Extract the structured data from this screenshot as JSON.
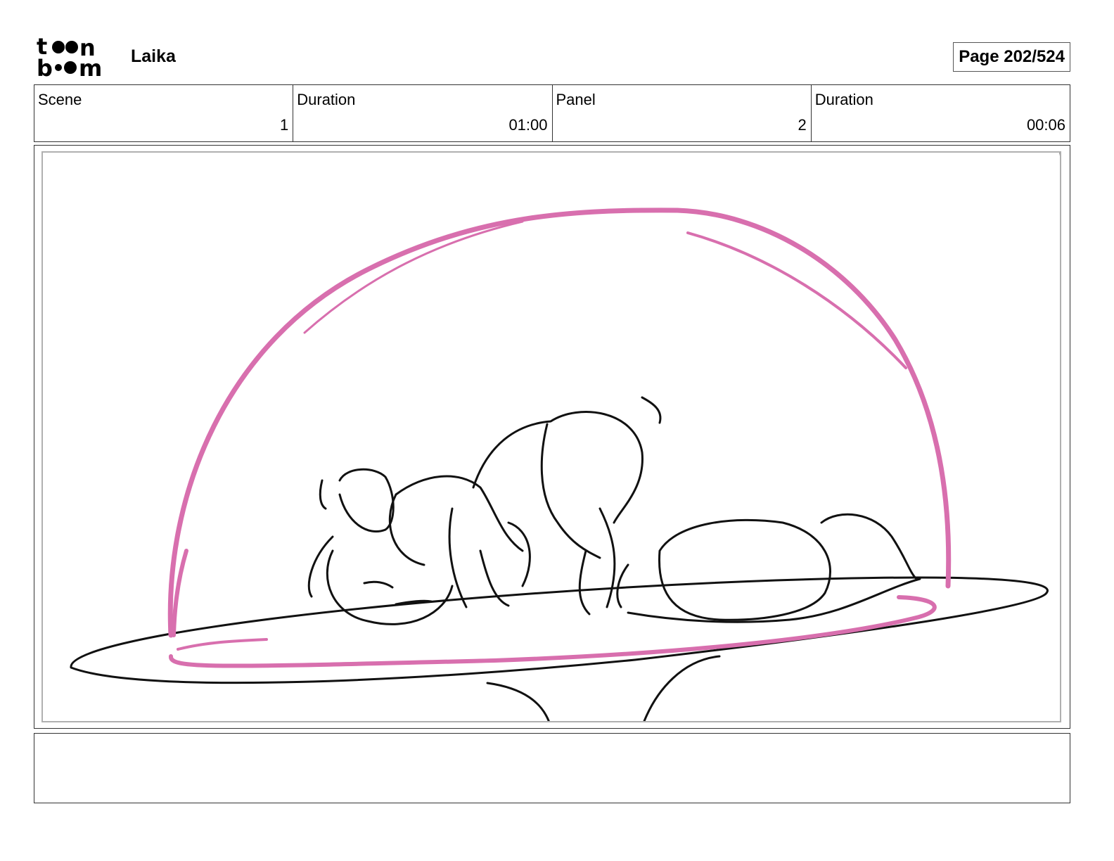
{
  "header": {
    "logo_line1": "toon",
    "logo_line2": "boom",
    "project_title": "Laika",
    "page_label": "Page 202/524"
  },
  "info": {
    "scene_label": "Scene",
    "scene_value": "1",
    "scene_duration_label": "Duration",
    "scene_duration_value": "01:00",
    "panel_label": "Panel",
    "panel_value": "2",
    "panel_duration_label": "Duration",
    "panel_duration_value": "00:06"
  },
  "panel": {
    "sketch_subject": "dog-under-glass-dome-sketch",
    "dome_color": "#d86fae",
    "line_color": "#111111"
  },
  "notes": {
    "text": ""
  }
}
